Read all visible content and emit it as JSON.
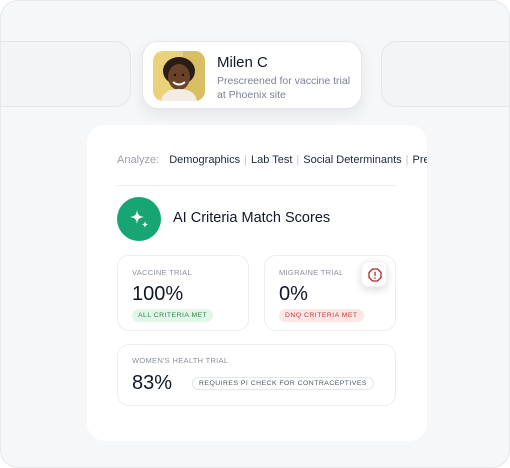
{
  "patient": {
    "name": "Milen C",
    "description": "Prescreened for vaccine trial at Phoenix site"
  },
  "analyze": {
    "label": "Analyze:",
    "items": [
      "Demographics",
      "Lab Test",
      "Social Determinants",
      "Presc"
    ]
  },
  "scores": {
    "title": "AI Criteria Match Scores",
    "vaccine": {
      "label": "VACCINE TRIAL",
      "score": "100%",
      "badge": "ALL CRITERIA MET"
    },
    "migraine": {
      "label": "MIGRAINE TRIAL",
      "score": "0%",
      "badge": "DNQ CRITERIA MET"
    },
    "women": {
      "label": "WOMEN'S HEALTH TRIAL",
      "score": "83%",
      "badge": "REQUIRES PI CHECK FOR CONTRACEPTIVES"
    }
  },
  "icons": {
    "ai": "sparkle-icon",
    "alert": "alert-octagon-icon"
  },
  "colors": {
    "accent_green": "#17a673",
    "success_text": "#1f8a47",
    "success_bg": "#e4f6ea",
    "danger_text": "#c03a3a",
    "danger_bg": "#fde6e6"
  }
}
